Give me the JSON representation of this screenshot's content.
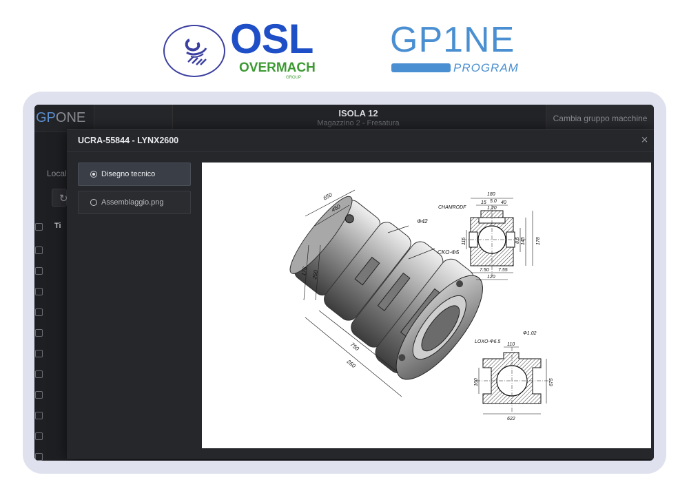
{
  "logos": {
    "osl": {
      "main": "OSL",
      "sub": "OVERMACH",
      "tiny": "GROUP"
    },
    "gpone": {
      "gp": "GP",
      "one": "1NE",
      "program": "PROGRAM"
    }
  },
  "app": {
    "logo_gp": "GP",
    "logo_one": "ONE",
    "title": "ISOLA 12",
    "subtitle": "Magazzino 2 - Fresatura",
    "switch_button": "Cambia gruppo macchine",
    "sidebar_label": "Locali",
    "table_header": "Ti"
  },
  "modal": {
    "title": "UCRA-55844 - LYNX2600",
    "close_icon": "×",
    "attachments": [
      {
        "label": "Disegno tecnico",
        "selected": true
      },
      {
        "label": "Assemblaggio.png",
        "selected": false
      }
    ]
  },
  "drawing": {
    "labels": {
      "d650": "650",
      "d450": "450",
      "d42": "Φ42",
      "d176": "176",
      "d250": "250",
      "cko": "CKO-Φ5",
      "d750": "750",
      "d260": "260",
      "chamfer": "CHAMRODF",
      "d180": "180",
      "d50": "5.0",
      "d15": "15",
      "d40": "40",
      "d120s": "1,20",
      "d115": "115",
      "d85": "8.5",
      "d145": "145",
      "d178": "178",
      "d750b": "7.50",
      "d755": "7.55",
      "d120": "120",
      "loxo": "LOXO-Φ6.5",
      "d110": "110",
      "d102": "Φ1.02",
      "d160": "160",
      "d675": "675",
      "d622": "622"
    }
  },
  "colors": {
    "accent": "#1f4fc7",
    "gpone": "#4a8fd1",
    "green": "#3c9a32",
    "modal_bg": "#25272b"
  }
}
